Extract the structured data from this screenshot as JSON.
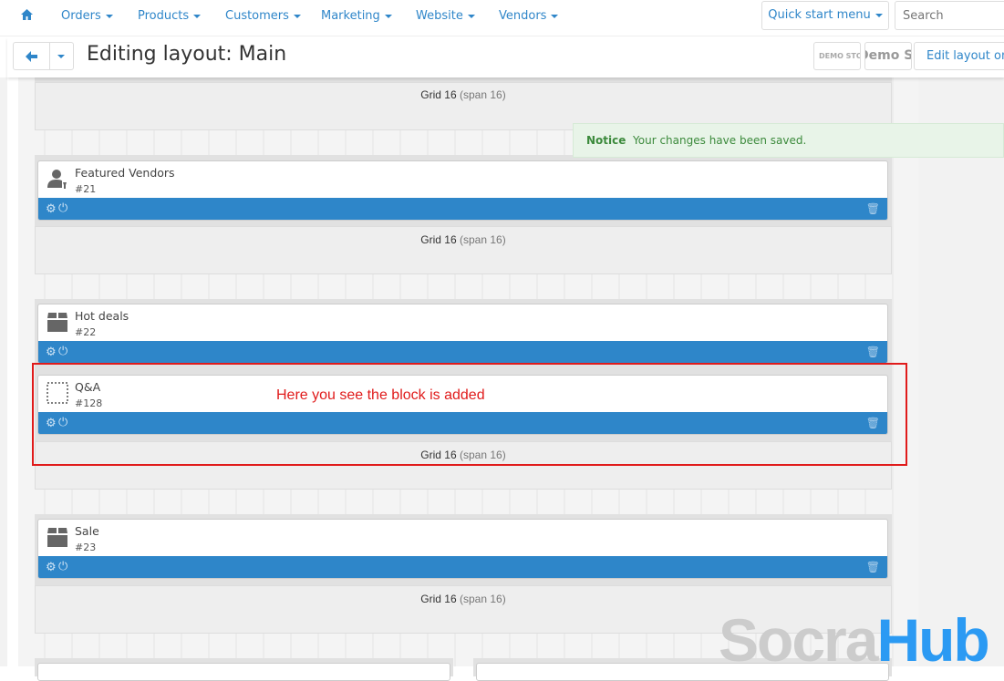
{
  "nav": {
    "items": [
      "Orders",
      "Products",
      "Customers",
      "Marketing",
      "Website",
      "Vendors"
    ],
    "quick_start": "Quick start menu",
    "search_placeholder": "Search"
  },
  "header": {
    "title": "Editing layout: Main",
    "demo_logo_1": "DEMO STORE",
    "demo_logo_2": "Demo Store",
    "edit_layout": "Edit layout on-"
  },
  "notice": {
    "label": "Notice",
    "text": "Your changes have been saved."
  },
  "grid": {
    "label": "Grid 16",
    "span": "(span 16)"
  },
  "blocks": [
    {
      "name": "Featured Vendors",
      "id": "#21",
      "icon": "vendor-icon"
    },
    {
      "name": "Hot deals",
      "id": "#22",
      "icon": "box-icon"
    },
    {
      "name": "Q&A",
      "id": "#128",
      "icon": "dotted-square-icon"
    },
    {
      "name": "Sale",
      "id": "#23",
      "icon": "box-icon"
    }
  ],
  "annotation": "Here you see the block is added",
  "watermark": {
    "part1": "Socra",
    "part2": "Hub",
    "color1": "#cccccc",
    "color2": "#2b9af3"
  },
  "colors": {
    "accent": "#2f86c9",
    "bar": "#2e86c9",
    "annotation": "#e01b1b"
  }
}
